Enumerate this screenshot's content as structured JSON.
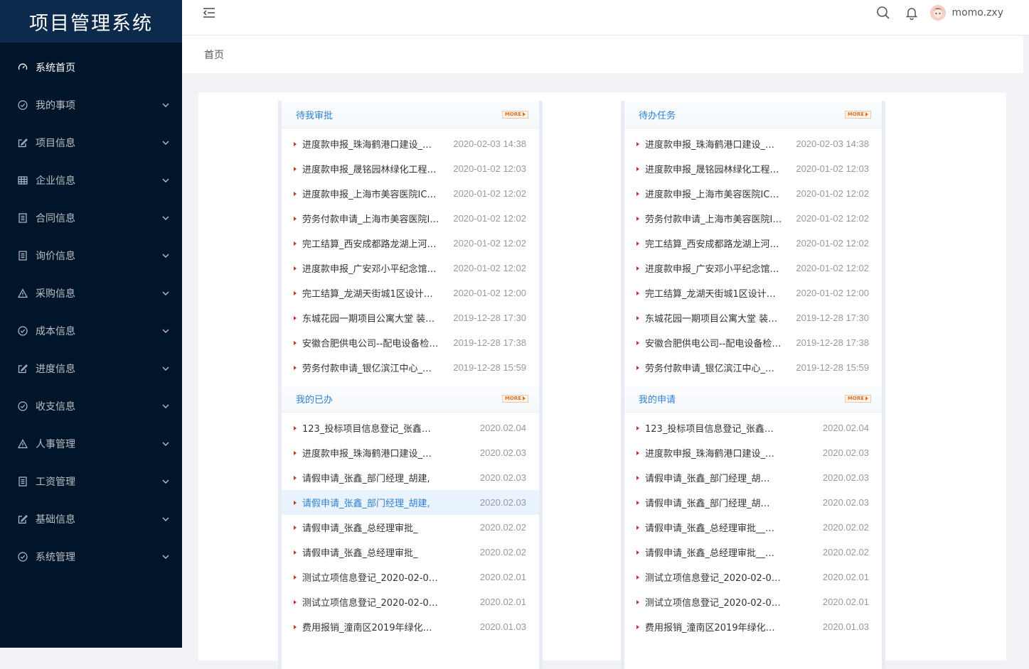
{
  "app": {
    "title": "项目管理系统"
  },
  "sidebar": {
    "items": [
      {
        "label": "系统首页",
        "icon": "dashboard-icon",
        "active": true,
        "expandable": false
      },
      {
        "label": "我的事项",
        "icon": "check-circle-icon",
        "expandable": true
      },
      {
        "label": "项目信息",
        "icon": "edit-icon",
        "expandable": true
      },
      {
        "label": "企业信息",
        "icon": "table-icon",
        "expandable": true
      },
      {
        "label": "合同信息",
        "icon": "document-icon",
        "expandable": true
      },
      {
        "label": "询价信息",
        "icon": "document-icon",
        "expandable": true
      },
      {
        "label": "采购信息",
        "icon": "warning-icon",
        "expandable": true
      },
      {
        "label": "成本信息",
        "icon": "check-circle-icon",
        "expandable": true
      },
      {
        "label": "进度信息",
        "icon": "edit-icon",
        "expandable": true
      },
      {
        "label": "收支信息",
        "icon": "check-circle-icon",
        "expandable": true
      },
      {
        "label": "人事管理",
        "icon": "warning-icon",
        "expandable": true
      },
      {
        "label": "工资管理",
        "icon": "document-icon",
        "expandable": true
      },
      {
        "label": "基础信息",
        "icon": "edit-icon",
        "expandable": true
      },
      {
        "label": "系统管理",
        "icon": "check-circle-icon",
        "expandable": true
      }
    ]
  },
  "header": {
    "username": "momo.zxy"
  },
  "breadcrumb": {
    "current": "首页"
  },
  "colors": {
    "sidebar_bg": "#001529",
    "logo_bg": "#0c2a4b",
    "accent": "#2f7fd0",
    "more": "#e07020"
  },
  "panels": {
    "pending_approval": {
      "title": "待我审批",
      "more": "MORE",
      "rows": [
        {
          "text": "进度款申报_珠海鹤港口建设_…",
          "date": "2020-02-03 14:38"
        },
        {
          "text": "进度款申报_晟铭园林绿化工程…",
          "date": "2020-01-02 12:03"
        },
        {
          "text": "进度款申报_上海市美容医院IC…",
          "date": "2020-01-02 12:02"
        },
        {
          "text": "劳务付款申请_上海市美容医院I…",
          "date": "2020-01-02 12:02"
        },
        {
          "text": "完工结算_西安成都路龙湖上河…",
          "date": "2020-01-02 12:02"
        },
        {
          "text": "进度款申报_广安邓小平纪念馆…",
          "date": "2020-01-02 12:02"
        },
        {
          "text": "完工结算_龙湖天街城1区设计…",
          "date": "2020-01-02 12:00"
        },
        {
          "text": "东城花园一期项目公寓大堂 装…",
          "date": "2019-12-28 17:30"
        },
        {
          "text": "安徽合肥供电公司--配电设备检…",
          "date": "2019-12-28 17:38"
        },
        {
          "text": "劳务付款申请_银亿滨江中心_…",
          "date": "2019-12-28 15:59"
        }
      ]
    },
    "todo_tasks": {
      "title": "待办任务",
      "more": "MORE",
      "rows": [
        {
          "text": "进度款申报_珠海鹤港口建设_…",
          "date": "2020-02-03 14:38"
        },
        {
          "text": "进度款申报_晟铭园林绿化工程…",
          "date": "2020-01-02 12:03"
        },
        {
          "text": "进度款申报_上海市美容医院IC…",
          "date": "2020-01-02 12:02"
        },
        {
          "text": "劳务付款申请_上海市美容医院I…",
          "date": "2020-01-02 12:02"
        },
        {
          "text": "完工结算_西安成都路龙湖上河…",
          "date": "2020-01-02 12:02"
        },
        {
          "text": "进度款申报_广安邓小平纪念馆…",
          "date": "2020-01-02 12:02"
        },
        {
          "text": "完工结算_龙湖天街城1区设计…",
          "date": "2020-01-02 12:00"
        },
        {
          "text": "东城花园一期项目公寓大堂 装…",
          "date": "2019-12-28 17:30"
        },
        {
          "text": "安徽合肥供电公司--配电设备检…",
          "date": "2019-12-28 17:38"
        },
        {
          "text": "劳务付款申请_银亿滨江中心_…",
          "date": "2019-12-28 15:59"
        }
      ]
    },
    "my_done": {
      "title": "我的已办",
      "more": "MORE",
      "rows": [
        {
          "text": "123_投标项目信息登记_张鑫…",
          "date": "2020.02.04"
        },
        {
          "text": "进度款申报_珠海鹤港口建设_…",
          "date": "2020.02.03"
        },
        {
          "text": "请假申请_张鑫_部门经理_胡建,",
          "date": "2020.02.03"
        },
        {
          "text": "请假申请_张鑫_部门经理_胡建,",
          "date": "2020.02.03",
          "highlight": true
        },
        {
          "text": "请假申请_张鑫_总经理审批_",
          "date": "2020.02.02"
        },
        {
          "text": "请假申请_张鑫_总经理审批_",
          "date": "2020.02.02"
        },
        {
          "text": "测试立项信息登记_2020-02-0…",
          "date": "2020.02.01"
        },
        {
          "text": "测试立项信息登记_2020-02-0…",
          "date": "2020.02.01"
        },
        {
          "text": "费用报销_潼南区2019年绿化…",
          "date": "2020.01.03"
        }
      ]
    },
    "my_requests": {
      "title": "我的申请",
      "more": "MORE",
      "rows": [
        {
          "text": "123_投标项目信息登记_张鑫…",
          "date": "2020.02.04"
        },
        {
          "text": "进度款申报_珠海鹤港口建设_…",
          "date": "2020.02.03"
        },
        {
          "text": "请假申请_张鑫_部门经理_胡…",
          "date": "2020.02.03"
        },
        {
          "text": "请假申请_张鑫_部门经理_胡…",
          "date": "2020.02.03"
        },
        {
          "text": "请假申请_张鑫_总经理审批__…",
          "date": "2020.02.02"
        },
        {
          "text": "请假申请_张鑫_总经理审批__…",
          "date": "2020.02.02"
        },
        {
          "text": "测试立项信息登记_2020-02-0…",
          "date": "2020.02.01"
        },
        {
          "text": "测试立项信息登记_2020-02-0…",
          "date": "2020.02.01"
        },
        {
          "text": "费用报销_潼南区2019年绿化…",
          "date": "2020.01.03"
        }
      ]
    }
  }
}
